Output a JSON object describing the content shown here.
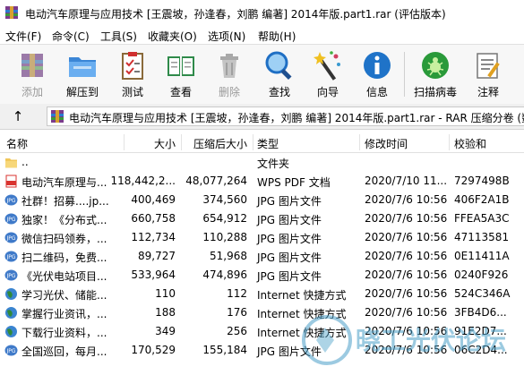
{
  "window": {
    "title": "电动汽车原理与应用技术 [王震坡，孙逢春，刘鹏 编著] 2014年版.part1.rar (评估版本)"
  },
  "menu": [
    "文件(F)",
    "命令(C)",
    "工具(S)",
    "收藏夹(O)",
    "选项(N)",
    "帮助(H)"
  ],
  "toolbar": [
    {
      "label": "添加",
      "icon": "add-archive-icon",
      "disabled": true
    },
    {
      "label": "解压到",
      "icon": "extract-to-icon",
      "disabled": false
    },
    {
      "label": "测试",
      "icon": "test-clipboard-icon",
      "disabled": false
    },
    {
      "label": "查看",
      "icon": "view-book-icon",
      "disabled": false
    },
    {
      "label": "删除",
      "icon": "delete-trash-icon",
      "disabled": true
    },
    {
      "label": "查找",
      "icon": "find-magnifier-icon",
      "disabled": false
    },
    {
      "label": "向导",
      "icon": "wizard-wand-icon",
      "disabled": false
    },
    {
      "label": "信息",
      "icon": "info-icon",
      "disabled": false
    },
    {
      "label": "扫描病毒",
      "icon": "virus-scan-icon",
      "disabled": false
    },
    {
      "label": "注释",
      "icon": "comment-icon",
      "disabled": false
    }
  ],
  "address": {
    "path": "电动汽车原理与应用技术 [王震坡，孙逢春，刘鹏 编著] 2014年版.part1.rar - RAR 压缩分卷 (数"
  },
  "columns": {
    "name": "名称",
    "size": "大小",
    "packed": "压缩后大小",
    "type": "类型",
    "modified": "修改时间",
    "crc": "校验和"
  },
  "files": [
    {
      "name": "..",
      "size": "",
      "packed": "",
      "type": "文件夹",
      "modified": "",
      "crc": "",
      "icon": "folder-icon"
    },
    {
      "name": "电动汽车原理与...",
      "size": "118,442,2...",
      "packed": "48,077,264",
      "type": "WPS PDF 文档",
      "modified": "2020/7/10 11...",
      "crc": "7297498B",
      "icon": "pdf-icon"
    },
    {
      "name": "社群！招募....jp...",
      "size": "400,469",
      "packed": "374,560",
      "type": "JPG 图片文件",
      "modified": "2020/7/6 10:56",
      "crc": "406F2A1B",
      "icon": "jpg-icon"
    },
    {
      "name": "独家！《分布式...",
      "size": "660,758",
      "packed": "654,912",
      "type": "JPG 图片文件",
      "modified": "2020/7/6 10:56",
      "crc": "FFEA5A3C",
      "icon": "jpg-icon"
    },
    {
      "name": "微信扫码领券，...",
      "size": "112,734",
      "packed": "110,288",
      "type": "JPG 图片文件",
      "modified": "2020/7/6 10:56",
      "crc": "47113581",
      "icon": "jpg-icon"
    },
    {
      "name": "扫二维码，免费...",
      "size": "89,727",
      "packed": "51,968",
      "type": "JPG 图片文件",
      "modified": "2020/7/6 10:56",
      "crc": "0E11411A",
      "icon": "jpg-icon"
    },
    {
      "name": "《光伏电站项目...",
      "size": "533,964",
      "packed": "474,896",
      "type": "JPG 图片文件",
      "modified": "2020/7/6 10:56",
      "crc": "0240F926",
      "icon": "jpg-icon"
    },
    {
      "name": "学习光伏、储能...",
      "size": "110",
      "packed": "112",
      "type": "Internet 快捷方式",
      "modified": "2020/7/6 10:56",
      "crc": "524C346A",
      "icon": "globe-icon"
    },
    {
      "name": "掌握行业资讯，...",
      "size": "188",
      "packed": "176",
      "type": "Internet 快捷方式",
      "modified": "2020/7/6 10:56",
      "crc": "3FB4D6...",
      "icon": "globe-icon"
    },
    {
      "name": "下载行业资料，...",
      "size": "349",
      "packed": "256",
      "type": "Internet 快捷方式",
      "modified": "2020/7/6 10:56",
      "crc": "91E2D7...",
      "icon": "globe-icon"
    },
    {
      "name": "全国巡回，每月...",
      "size": "170,529",
      "packed": "155,184",
      "type": "JPG 图片文件",
      "modified": "2020/7/6 10:56",
      "crc": "06C2D4...",
      "icon": "jpg-icon"
    }
  ],
  "watermark": {
    "text": "晓工光伏论坛"
  },
  "colors": {
    "toolbar_bg": "#f7f7f7",
    "disabled_text": "#9a9a9a",
    "folder": "#f1c75a",
    "pdf": "#d9332f",
    "jpg": "#3f7ac9",
    "globe": "#2f8a3a",
    "watermark": "#4a9fc8"
  }
}
